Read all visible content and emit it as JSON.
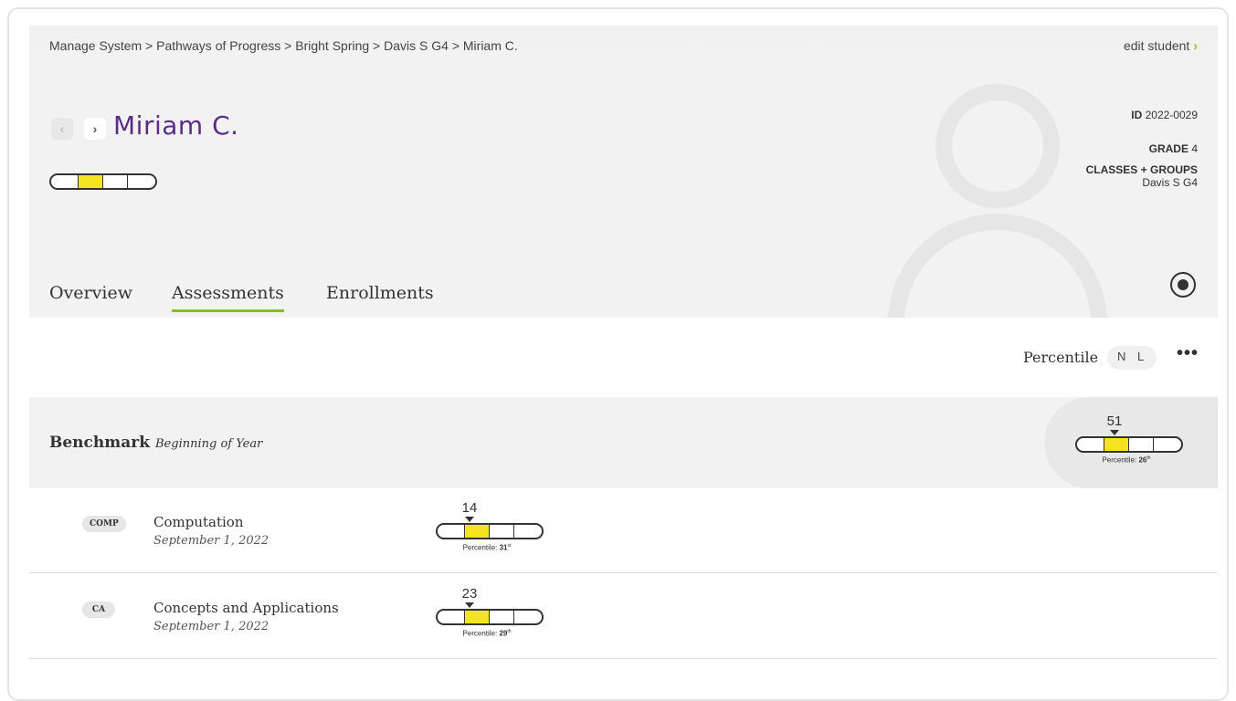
{
  "breadcrumb": "Manage System > Pathways of Progress > Bright Spring > Davis S G4 > Miriam C.",
  "edit_student": {
    "label": "edit student",
    "chevron": "›"
  },
  "nav": {
    "prev": "‹",
    "next": "›"
  },
  "student": {
    "name": "Miriam C.",
    "id_label": "ID",
    "id_value": "2022-0029",
    "grade_label": "GRADE",
    "grade_value": "4",
    "classes_label": "CLASSES + GROUPS",
    "classes_value": "Davis S G4",
    "gauge_level": 2
  },
  "tabs": [
    {
      "label": "Overview",
      "active": false
    },
    {
      "label": "Assessments",
      "active": true
    },
    {
      "label": "Enrollments",
      "active": false
    }
  ],
  "toolbar": {
    "label": "Percentile",
    "toggle_n": "N",
    "toggle_l": "L",
    "more": "•••"
  },
  "benchmark": {
    "title": "Benchmark",
    "subtitle": "Beginning of Year",
    "score": "51",
    "percentile_label": "Percentile:",
    "percentile": "26",
    "suffix": "th",
    "gauge_level": 2
  },
  "assessments": [
    {
      "badge": "COMP",
      "title": "Computation",
      "date": "September 1, 2022",
      "score": "14",
      "percentile_label": "Percentile:",
      "percentile": "31",
      "suffix": "st",
      "gauge_level": 2
    },
    {
      "badge": "CA",
      "title": "Concepts and Applications",
      "date": "September 1, 2022",
      "score": "23",
      "percentile_label": "Percentile:",
      "percentile": "29",
      "suffix": "th",
      "gauge_level": 2
    }
  ],
  "colors": {
    "accent": "#7ec21c",
    "name": "#5b2d86",
    "gauge_fill": "#f4e323"
  }
}
